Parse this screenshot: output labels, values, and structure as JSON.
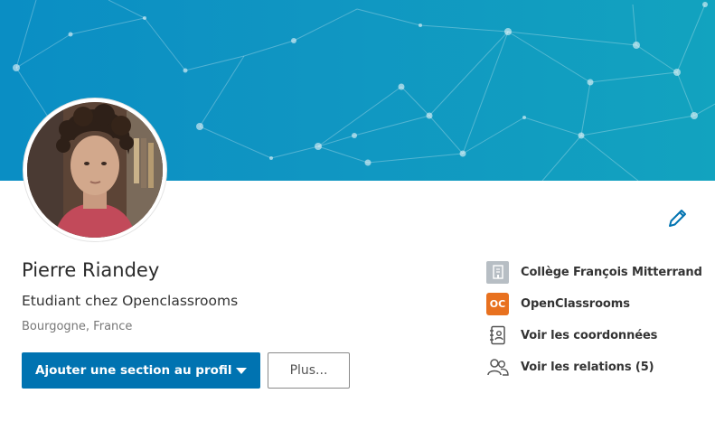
{
  "profile": {
    "name": "Pierre Riandey",
    "headline": "Etudiant chez Openclassrooms",
    "location": "Bourgogne, France"
  },
  "actions": {
    "primary_label": "Ajouter une section au profil",
    "secondary_label": "Plus..."
  },
  "sidebar": {
    "items": [
      {
        "label": "Collège François Mitterrand",
        "icon": "school-icon"
      },
      {
        "label": "OpenClassrooms",
        "icon": "openclassrooms-logo",
        "logo_text": "OC"
      },
      {
        "label": "Voir les coordonnées",
        "icon": "contact-card-icon"
      },
      {
        "label": "Voir les relations (5)",
        "icon": "people-icon"
      }
    ]
  },
  "colors": {
    "primary_blue": "#0073b1",
    "cover_blue": "#0a8ec4",
    "oc_orange": "#e8711f",
    "edit_icon": "#0073b1"
  }
}
